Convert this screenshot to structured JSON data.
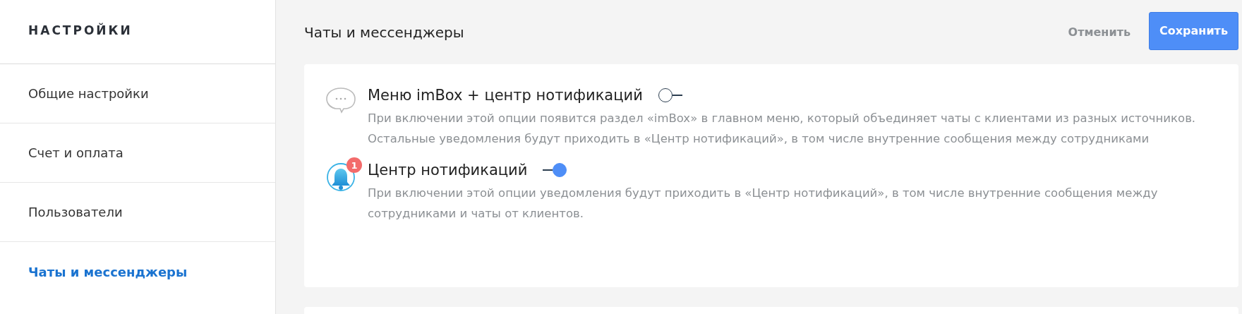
{
  "sidebar": {
    "title": "НАСТРОЙКИ",
    "items": [
      {
        "label": "Общие настройки",
        "selected": false
      },
      {
        "label": "Счет и оплата",
        "selected": false
      },
      {
        "label": "Пользователи",
        "selected": false
      },
      {
        "label": "Чаты и мессенджеры",
        "selected": true
      }
    ]
  },
  "header": {
    "title": "Чаты и мессенджеры",
    "cancel": "Отменить",
    "save": "Сохранить"
  },
  "options": [
    {
      "kind": "chat",
      "title": "Меню imBox + центр нотификаций",
      "on": false,
      "description": "При включении этой опции появится раздел «imBox» в главном меню, который объединяет чаты с клиентами из разных источников. Остальные уведомления будут приходить в «Центр нотификаций», в том числе внутренние сообщения между сотрудниками"
    },
    {
      "kind": "bell",
      "title": "Центр нотификаций",
      "on": true,
      "badge": "1",
      "description": "При включении этой опции уведомления будут приходить в «Центр нотификаций», в том числе внутренние сообщения между сотрудниками и чаты от клиентов."
    }
  ]
}
